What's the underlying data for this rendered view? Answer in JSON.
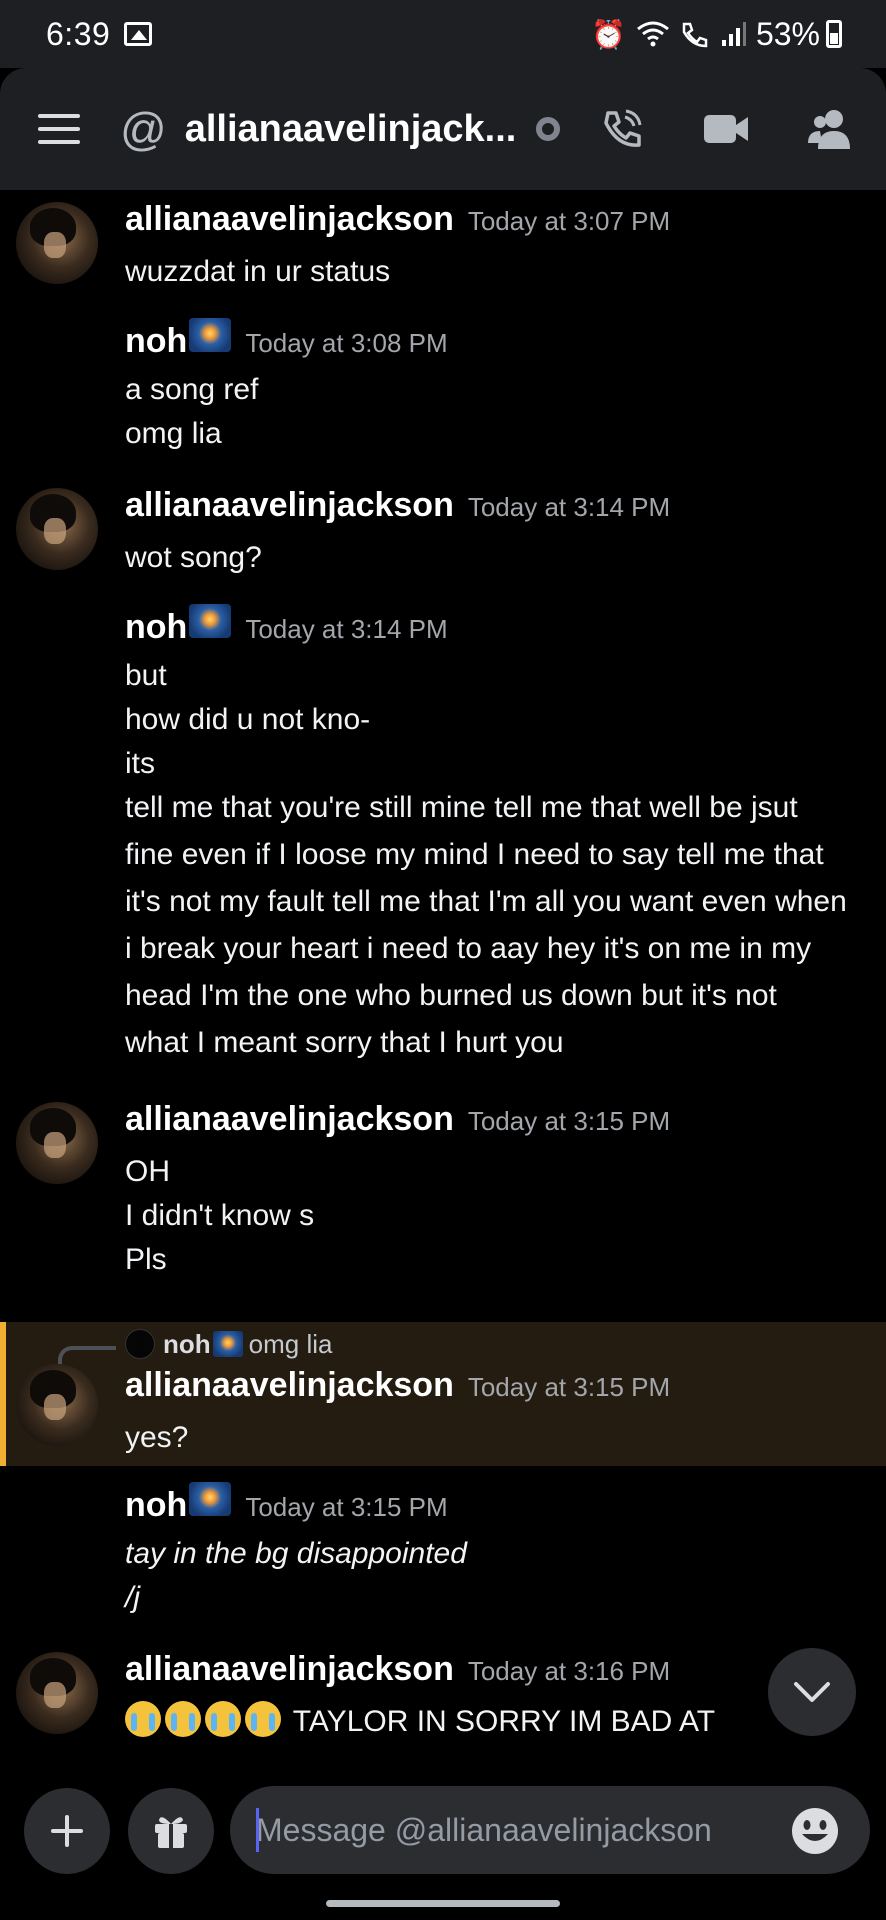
{
  "statusbar": {
    "time": "6:39",
    "battery": "53%",
    "icons": [
      "gallery-icon",
      "alarm-icon",
      "wifi-icon",
      "wifi-call-icon",
      "signal-icon",
      "battery-icon"
    ]
  },
  "header": {
    "at_symbol": "@",
    "channel_name": "allianaavelinjack...",
    "icons": [
      "menu-icon",
      "status-icon",
      "call-icon",
      "video-icon",
      "members-icon"
    ]
  },
  "messages": [
    {
      "author": "allianaavelinjackson",
      "timestamp": "Today at 3:07 PM",
      "lines": [
        "wuzzdat in ur status"
      ]
    },
    {
      "author": "noh",
      "timestamp": "Today at 3:08 PM",
      "lines": [
        "a song ref",
        "omg lia"
      ]
    },
    {
      "author": "allianaavelinjackson",
      "timestamp": "Today at 3:14 PM",
      "lines": [
        "wot song?"
      ]
    },
    {
      "author": "noh",
      "timestamp": "Today at 3:14 PM",
      "lines": [
        "but",
        "how did u not kno-",
        "its"
      ],
      "lyrics": "tell me that you're still mine tell me that well be jsut fine even if I loose my mind I need to say tell me that it's not my fault tell me that I'm all you want even when i break your heart i need to aay hey it's on me in my head I'm the one who burned us down but it's not what I meant sorry that I hurt you"
    },
    {
      "author": "allianaavelinjackson",
      "timestamp": "Today at 3:15 PM",
      "lines": [
        "OH",
        "I didn't know s",
        "Pls"
      ]
    },
    {
      "reply_to": {
        "author": "noh",
        "text": "omg lia"
      },
      "author": "allianaavelinjackson",
      "timestamp": "Today at 3:15 PM",
      "lines": [
        "yes?"
      ]
    },
    {
      "author": "noh",
      "timestamp": "Today at 3:15 PM",
      "lines": [
        "tay in the bg disappointed",
        "/j"
      ]
    },
    {
      "author": "allianaavelinjackson",
      "timestamp": "Today at 3:16 PM",
      "lines": [
        "TAYLOR IN SORRY IM BAD AT"
      ]
    }
  ],
  "composer": {
    "placeholder": "Message @allianaavelinjackson",
    "icons": [
      "plus-icon",
      "gift-icon",
      "emoji-icon"
    ]
  },
  "colors": {
    "background": "#000000",
    "header_bg": "#1e1f22",
    "reply_highlight": "#241c10",
    "reply_accent": "#f0b132",
    "timestamp": "#a3a6aa"
  }
}
